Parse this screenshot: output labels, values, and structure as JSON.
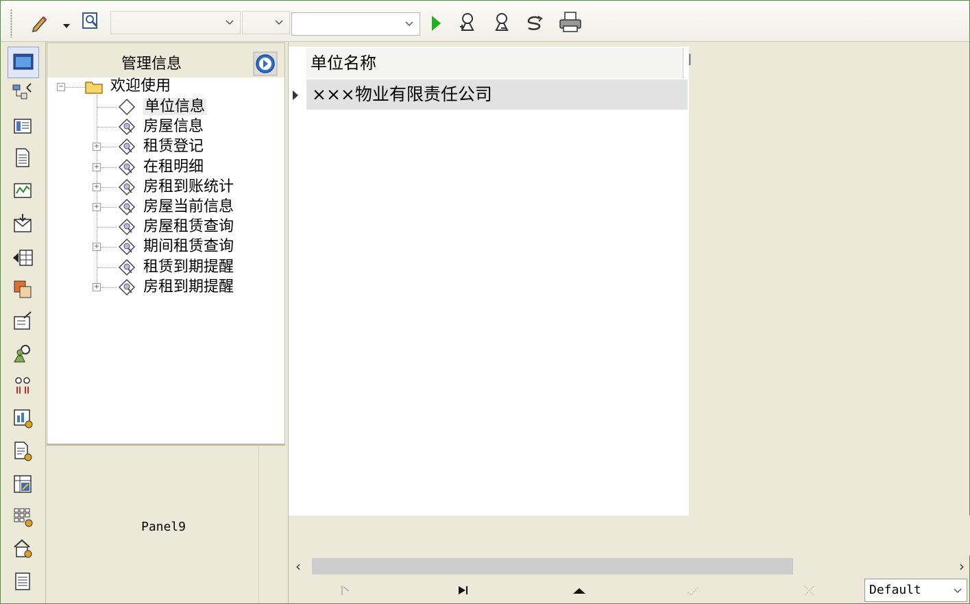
{
  "toolbar": {
    "icons": [
      "pencil-icon",
      "dropdown-arrow-icon",
      "preview-icon",
      "run-icon",
      "zoom-in-icon",
      "zoom-out-icon",
      "refresh-icon",
      "print-icon"
    ],
    "combos": [
      {
        "value": ""
      },
      {
        "value": ""
      },
      {
        "value": ""
      }
    ]
  },
  "sidebar_icons": [
    "window-icon",
    "hierarchy-icon",
    "list-card-icon",
    "document-icon",
    "chart-monitor-icon",
    "envelope-icon",
    "grid-arrow-icon",
    "tiles-icon",
    "form-edit-icon",
    "user-search-icon",
    "connection-icon",
    "report-icon",
    "document-gear-icon",
    "table-export-icon",
    "keypad-icon",
    "house-gear-icon",
    "notes-icon"
  ],
  "tree": {
    "header": "管理信息",
    "root": "欢迎使用",
    "items": [
      {
        "label": "单位信息",
        "expandable": false,
        "selected": true
      },
      {
        "label": "房屋信息",
        "expandable": false
      },
      {
        "label": "租赁登记",
        "expandable": true
      },
      {
        "label": "在租明细",
        "expandable": true
      },
      {
        "label": "房租到账统计",
        "expandable": true
      },
      {
        "label": "房屋当前信息",
        "expandable": true
      },
      {
        "label": "房屋租赁查询",
        "expandable": false
      },
      {
        "label": "期间租赁查询",
        "expandable": true
      },
      {
        "label": "租赁到期提醒",
        "expandable": false
      },
      {
        "label": "房租到期提醒",
        "expandable": true
      }
    ]
  },
  "panel9": {
    "label": "Panel9"
  },
  "grid": {
    "columns": [
      "单位名称",
      "I"
    ],
    "rows": [
      [
        "×××物业有限责任公司"
      ]
    ]
  },
  "navigator": {
    "buttons": [
      "first-record-icon",
      "last-record-icon",
      "up-icon",
      "post-icon",
      "cancel-icon"
    ],
    "select": {
      "value": "Default"
    }
  },
  "colors": {
    "frame": "#4f8f3a",
    "background": "#ece9d8",
    "play": "#22b022"
  }
}
